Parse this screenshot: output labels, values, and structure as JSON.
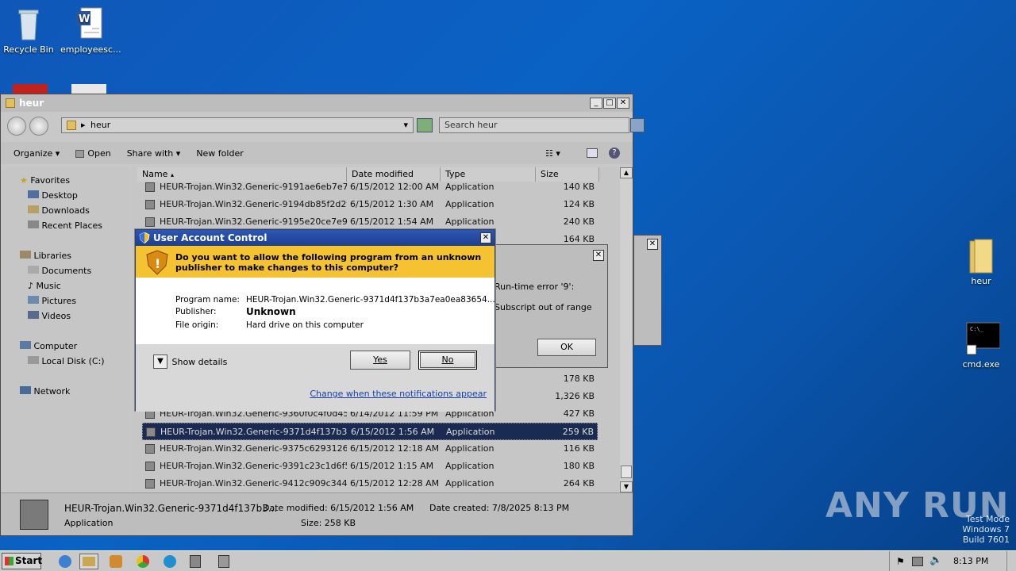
{
  "desktop": {
    "icons": [
      {
        "label": "Recycle Bin"
      },
      {
        "label": "employeesc..."
      },
      {
        "label": "heur"
      },
      {
        "label": "cmd.exe"
      }
    ]
  },
  "explorer": {
    "title": "heur",
    "address": "heur",
    "search_placeholder": "Search heur",
    "toolbar": [
      "Organize",
      "Open",
      "Share with",
      "New folder"
    ],
    "nav": {
      "favorites": "Favorites",
      "fav_items": [
        "Desktop",
        "Downloads",
        "Recent Places"
      ],
      "libraries": "Libraries",
      "lib_items": [
        "Documents",
        "Music",
        "Pictures",
        "Videos"
      ],
      "computer": "Computer",
      "comp_items": [
        "Local Disk (C:)"
      ],
      "network": "Network"
    },
    "columns": [
      "Name",
      "Date modified",
      "Type",
      "Size"
    ],
    "rows_top": [
      {
        "name": "HEUR-Trojan.Win32.Generic-9191ae6eb7e7...",
        "date": "6/15/2012 12:00 AM",
        "type": "Application",
        "size": "140 KB"
      },
      {
        "name": "HEUR-Trojan.Win32.Generic-9194db85f2d2f...",
        "date": "6/15/2012 1:30 AM",
        "type": "Application",
        "size": "124 KB"
      },
      {
        "name": "HEUR-Trojan.Win32.Generic-9195e20ce7e9...",
        "date": "6/15/2012 1:54 AM",
        "type": "Application",
        "size": "240 KB"
      },
      {
        "name": "",
        "date": "",
        "type": "",
        "size": "164 KB"
      }
    ],
    "rows_bottom": [
      {
        "name": "",
        "date": "",
        "type": "",
        "size": "178 KB"
      },
      {
        "name": "",
        "date": "",
        "type": "",
        "size": "1,326 KB"
      },
      {
        "name": "HEUR-Trojan.Win32.Generic-9360f0c4f0d45...",
        "date": "6/14/2012 11:59 PM",
        "type": "Application",
        "size": "427 KB"
      },
      {
        "name": "HEUR-Trojan.Win32.Generic-9371d4f137b3a...",
        "date": "6/15/2012 1:56 AM",
        "type": "Application",
        "size": "259 KB",
        "selected": true
      },
      {
        "name": "HEUR-Trojan.Win32.Generic-9375c6293126...",
        "date": "6/15/2012 12:18 AM",
        "type": "Application",
        "size": "116 KB"
      },
      {
        "name": "HEUR-Trojan.Win32.Generic-9391c23c1d6f5...",
        "date": "6/15/2012 1:15 AM",
        "type": "Application",
        "size": "180 KB"
      },
      {
        "name": "HEUR-Trojan.Win32.Generic-9412c909c3448...",
        "date": "6/15/2012 12:28 AM",
        "type": "Application",
        "size": "264 KB"
      }
    ],
    "details": {
      "name": "HEUR-Trojan.Win32.Generic-9371d4f137b3...",
      "kind": "Application",
      "date_modified": "Date modified: 6/15/2012 1:56 AM",
      "date_created": "Date created: 7/8/2025 8:13 PM",
      "size": "Size: 258 KB"
    }
  },
  "error_dialog": {
    "line1": "Run-time error '9':",
    "line2": "Subscript out of range",
    "ok": "OK"
  },
  "uac": {
    "title": "User Account Control",
    "question": "Do you want to allow the following program from an unknown publisher to make changes to this computer?",
    "program_label": "Program name:",
    "program_value": "HEUR-Trojan.Win32.Generic-9371d4f137b3a7ea0ea83654...",
    "publisher_label": "Publisher:",
    "publisher_value": "Unknown",
    "origin_label": "File origin:",
    "origin_value": "Hard drive on this computer",
    "show_details": "Show details",
    "yes": "Yes",
    "no": "No",
    "link": "Change when these notifications appear"
  },
  "taskbar": {
    "start": "Start",
    "clock": "8:13 PM"
  },
  "watermark": {
    "line1": "Test Mode",
    "line2": "Windows 7",
    "line3": "Build 7601",
    "brand": "ANY RUN"
  }
}
